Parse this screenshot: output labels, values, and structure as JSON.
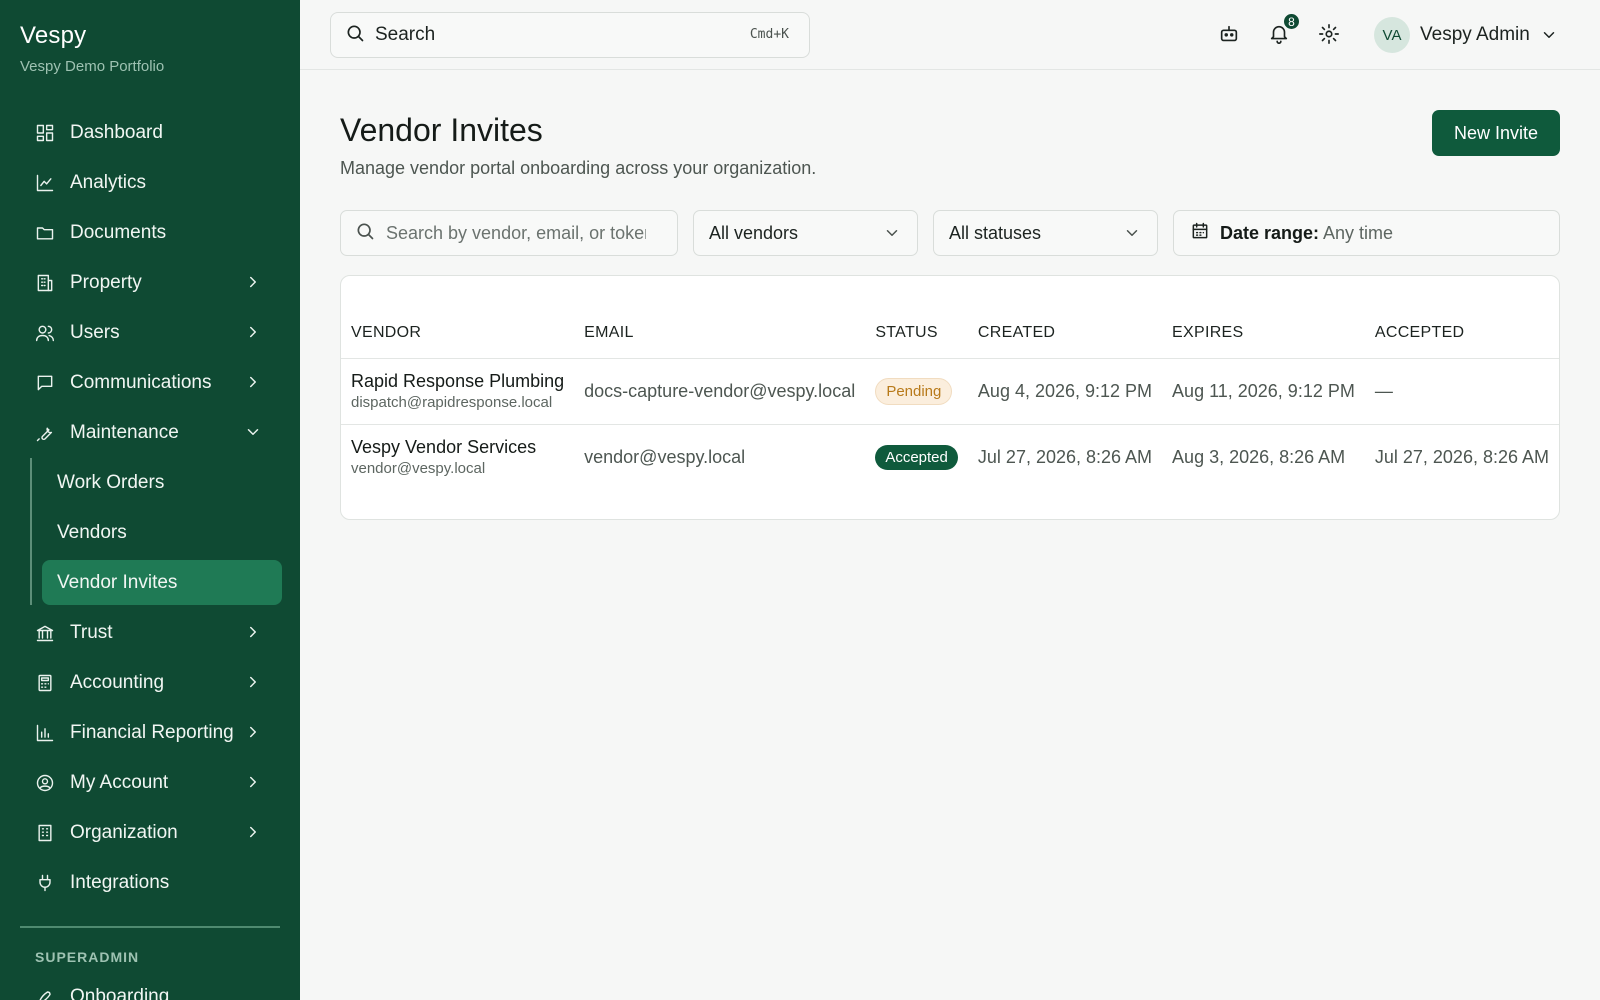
{
  "brand": {
    "name": "Vespy",
    "subtitle": "Vespy Demo Portfolio"
  },
  "sidebar": {
    "items": [
      {
        "label": "Dashboard",
        "icon": "dashboard-icon",
        "expandable": false
      },
      {
        "label": "Analytics",
        "icon": "line-chart-icon",
        "expandable": false
      },
      {
        "label": "Documents",
        "icon": "folder-icon",
        "expandable": false
      },
      {
        "label": "Property",
        "icon": "building-icon",
        "expandable": true
      },
      {
        "label": "Users",
        "icon": "users-icon",
        "expandable": true
      },
      {
        "label": "Communications",
        "icon": "message-icon",
        "expandable": true
      },
      {
        "label": "Maintenance",
        "icon": "wrench-icon",
        "expanded": true
      }
    ],
    "maintenance_children": [
      {
        "label": "Work Orders"
      },
      {
        "label": "Vendors"
      },
      {
        "label": "Vendor Invites",
        "active": true
      }
    ],
    "items_after": [
      {
        "label": "Trust",
        "icon": "bank-icon",
        "expandable": true
      },
      {
        "label": "Accounting",
        "icon": "calculator-icon",
        "expandable": true
      },
      {
        "label": "Financial Reporting",
        "icon": "bar-chart-icon",
        "expandable": true
      },
      {
        "label": "My Account",
        "icon": "user-circle-icon",
        "expandable": true
      },
      {
        "label": "Organization",
        "icon": "office-building-icon",
        "expandable": true
      },
      {
        "label": "Integrations",
        "icon": "plug-icon",
        "expandable": false
      }
    ],
    "section_label": "SUPERADMIN",
    "superadmin_items": [
      {
        "label": "Onboarding",
        "icon": "rocket-icon"
      }
    ]
  },
  "topbar": {
    "search_label": "Search",
    "search_shortcut": "Cmd+K",
    "notification_count": "8",
    "user": {
      "initials": "VA",
      "name": "Vespy Admin"
    }
  },
  "page": {
    "title": "Vendor Invites",
    "subtitle": "Manage vendor portal onboarding across your organization.",
    "new_button": "New Invite"
  },
  "filters": {
    "search_placeholder": "Search by vendor, email, or token",
    "vendor_select": "All vendors",
    "status_select": "All statuses",
    "date_label": "Date range:",
    "date_value": "Any time"
  },
  "table": {
    "columns": [
      "VENDOR",
      "EMAIL",
      "STATUS",
      "CREATED",
      "EXPIRES",
      "ACCEPTED"
    ],
    "rows": [
      {
        "vendor": "Rapid Response Plumbing",
        "vendor_email": "dispatch@rapidresponse.local",
        "email": "docs-capture-vendor@vespy.local",
        "status": "Pending",
        "created": "Aug 4, 2026, 9:12 PM",
        "expires": "Aug 11, 2026, 9:12 PM",
        "accepted": "—"
      },
      {
        "vendor": "Vespy Vendor Services",
        "vendor_email": "vendor@vespy.local",
        "email": "vendor@vespy.local",
        "status": "Accepted",
        "created": "Jul 27, 2026, 8:26 AM",
        "expires": "Aug 3, 2026, 8:26 AM",
        "accepted": "Jul 27, 2026, 8:26 AM"
      }
    ]
  },
  "colors": {
    "sidebar_bg": "#0f4a33",
    "accent": "#0f5a3c",
    "active_nav": "#1f7a55",
    "pending": "#b87a1a"
  }
}
